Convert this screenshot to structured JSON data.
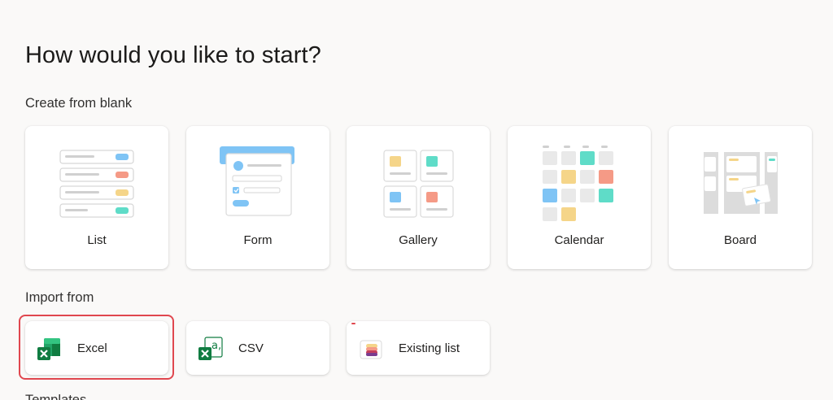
{
  "header": {
    "title": "How would you like to start?"
  },
  "sections": {
    "blank_label": "Create from blank",
    "import_label": "Import from",
    "templates_label": "Templates"
  },
  "blank_options": [
    {
      "label": "List",
      "icon": "list-icon"
    },
    {
      "label": "Form",
      "icon": "form-icon"
    },
    {
      "label": "Gallery",
      "icon": "gallery-icon"
    },
    {
      "label": "Calendar",
      "icon": "calendar-icon"
    },
    {
      "label": "Board",
      "icon": "board-icon"
    }
  ],
  "import_options": [
    {
      "label": "Excel",
      "icon": "excel-icon",
      "selected": true
    },
    {
      "label": "CSV",
      "icon": "csv-icon",
      "selected": false
    },
    {
      "label": "Existing list",
      "icon": "existing-list-icon",
      "selected": false
    }
  ],
  "colors": {
    "selection_ring": "#e0474f",
    "blue": "#7fc4f5",
    "teal": "#5fdcc8",
    "salmon": "#f59a86",
    "yellow": "#f5d589",
    "excel_green": "#107c41"
  }
}
